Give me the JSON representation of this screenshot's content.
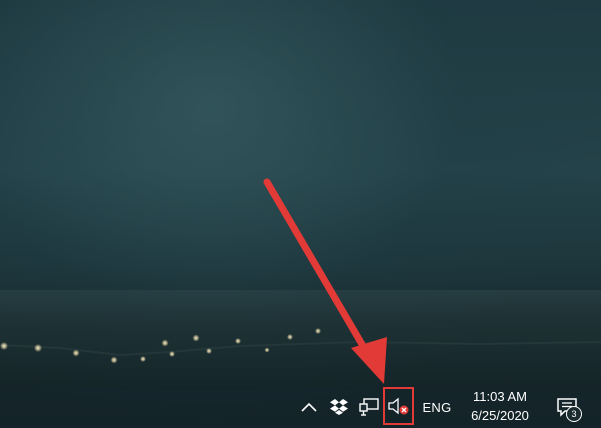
{
  "desktop": {
    "wallpaper": "dark teal sky with distant shoreline lights"
  },
  "tray": {
    "show_hidden_icon": "chevron-up-icon",
    "dropbox_icon": "dropbox-icon",
    "network_icon": "network-icon",
    "volume_icon": "speaker-muted-icon",
    "language": "ENG",
    "time": "11:03 AM",
    "date": "6/25/2020",
    "notification_count": "3"
  },
  "annotation": {
    "arrow_color": "#e23a36",
    "highlight_color": "#e23a36"
  }
}
